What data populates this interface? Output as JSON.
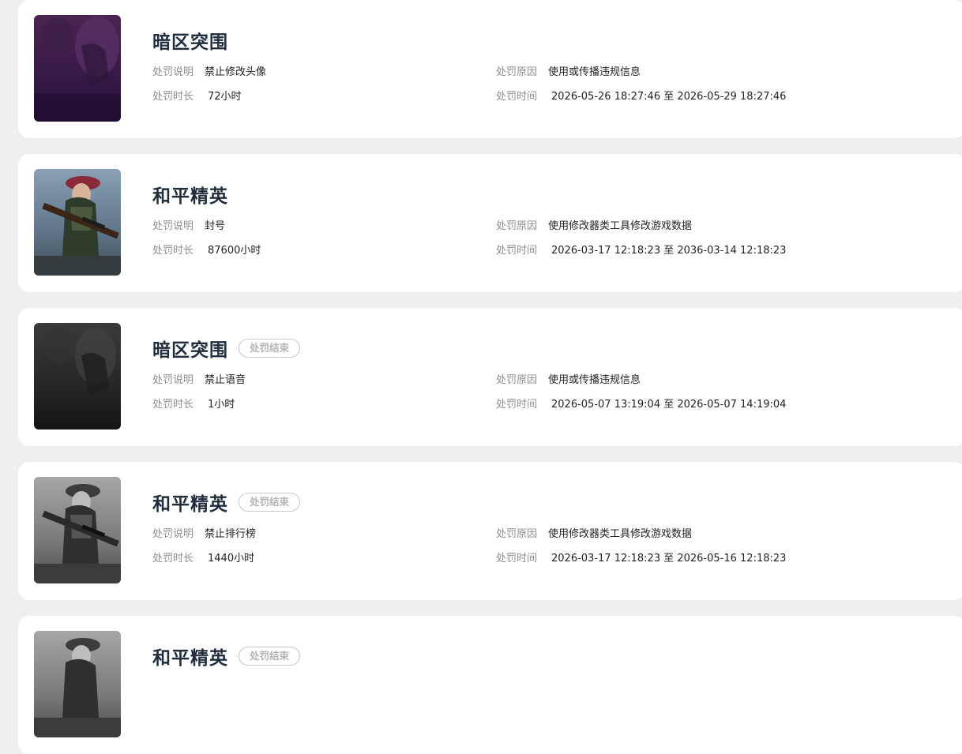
{
  "records": [
    {
      "game": "暗区突围",
      "status_badge": "",
      "desc_label": "处罚说明",
      "desc_value": "禁止修改头像",
      "reason_label": "处罚原因",
      "reason_value": "使用或传播违规信息",
      "duration_label": "处罚时长",
      "duration_value": "72小时",
      "time_label": "处罚时间",
      "time_value": "2026-05-26 18:27:46 至 2026-05-29 18:27:46",
      "thumb_style": "purple"
    },
    {
      "game": "和平精英",
      "status_badge": "",
      "desc_label": "处罚说明",
      "desc_value": "封号",
      "reason_label": "处罚原因",
      "reason_value": "使用修改器类工具修改游戏数据",
      "duration_label": "处罚时长",
      "duration_value": "87600小时",
      "time_label": "处罚时间",
      "time_value": "2026-03-17 12:18:23 至 2036-03-14 12:18:23",
      "thumb_style": "color"
    },
    {
      "game": "暗区突围",
      "status_badge": "处罚结束",
      "desc_label": "处罚说明",
      "desc_value": "禁止语音",
      "reason_label": "处罚原因",
      "reason_value": "使用或传播违规信息",
      "duration_label": "处罚时长",
      "duration_value": "1小时",
      "time_label": "处罚时间",
      "time_value": "2026-05-07 13:19:04 至 2026-05-07 14:19:04",
      "thumb_style": "dark"
    },
    {
      "game": "和平精英",
      "status_badge": "处罚结束",
      "desc_label": "处罚说明",
      "desc_value": "禁止排行榜",
      "reason_label": "处罚原因",
      "reason_value": "使用修改器类工具修改游戏数据",
      "duration_label": "处罚时长",
      "duration_value": "1440小时",
      "time_label": "处罚时间",
      "time_value": "2026-03-17 12:18:23 至 2026-05-16 12:18:23",
      "thumb_style": "gray"
    },
    {
      "game": "和平精英",
      "status_badge": "处罚结束",
      "thumb_style": "gray"
    }
  ],
  "colors": {
    "page_bg": "#efefef",
    "card_bg": "#ffffff",
    "title": "#1f2d3d",
    "label": "#8e8e8e",
    "badge_text": "#b5b5b5"
  }
}
